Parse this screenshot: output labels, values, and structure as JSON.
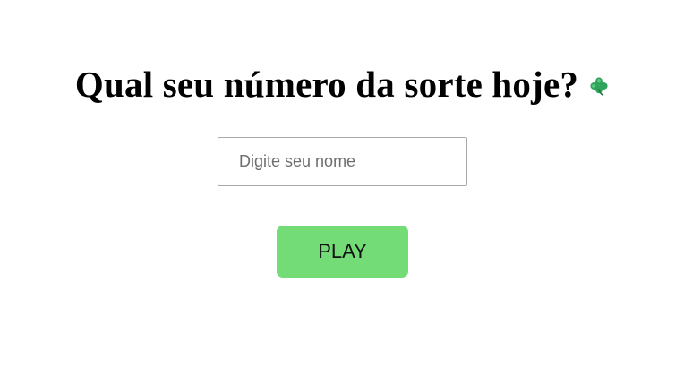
{
  "header": {
    "title": "Qual seu número da sorte hoje?",
    "icon": "four-leaf-clover-icon",
    "icon_color": "#2fa35a"
  },
  "form": {
    "name_placeholder": "Digite seu nome",
    "name_value": "",
    "play_label": "PLAY",
    "play_color": "#73dc76"
  }
}
